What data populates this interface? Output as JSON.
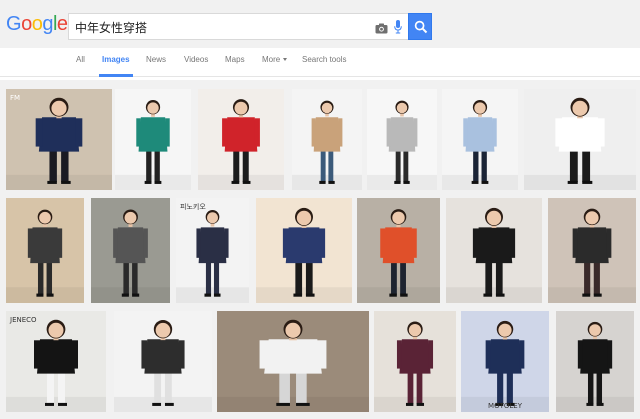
{
  "logo": {
    "letters": [
      "G",
      "o",
      "o",
      "g",
      "l",
      "e"
    ]
  },
  "search": {
    "query": "中年女性穿搭"
  },
  "tabs": [
    {
      "label": "All"
    },
    {
      "label": "Images"
    },
    {
      "label": "News"
    },
    {
      "label": "Videos"
    },
    {
      "label": "Maps"
    },
    {
      "label": "More"
    },
    {
      "label": "Search tools"
    }
  ],
  "results": {
    "row1": [
      {
        "watermark": "FM",
        "bg": "#cfc2b0",
        "coat": "#1f2f5a",
        "pants": "#1a1a22"
      },
      {
        "bg": "#f6f6f6",
        "coat": "#1e8a7a",
        "pants": "#222"
      },
      {
        "bg": "#f2eeea",
        "coat": "#d0232a",
        "pants": "#1c1c1c"
      },
      {
        "bg": "#f4f4f4",
        "coat": "#c9a27a",
        "pants": "#3b5a7a"
      },
      {
        "bg": "#f7f7f7",
        "coat": "#b9b9b9",
        "pants": "#2a2a2a"
      },
      {
        "bg": "#f5f5f5",
        "coat": "#a9c1df",
        "pants": "#1b2436"
      },
      {
        "bg": "#efefef",
        "coat": "#ffffff",
        "pants": "#1b1b1b"
      }
    ],
    "row2": [
      {
        "bg": "#d7c4a8",
        "coat": "#3a3a3a",
        "pants": "#2a2a2a"
      },
      {
        "bg": "#9a9a92",
        "coat": "#555555",
        "pants": "#2a2a2a"
      },
      {
        "watermark": "피노키오",
        "bg": "#f3f3f3",
        "coat": "#2a2f45",
        "pants": "#2a2f45"
      },
      {
        "bg": "#f2e4d2",
        "coat": "#2a3a6e",
        "pants": "#1a1a1a"
      },
      {
        "bg": "#b8b0a5",
        "coat": "#e0502a",
        "pants": "#1e2430"
      },
      {
        "bg": "#e6e2dd",
        "coat": "#1a1a1a",
        "pants": "#1a1a1a"
      },
      {
        "bg": "#cfc3b8",
        "coat": "#2b2b2b",
        "pants": "#3a2a2a"
      }
    ],
    "row3": [
      {
        "watermark": "JENECO",
        "bg": "#e9e9e6",
        "coat": "#141414",
        "pants": "#f4f4f4"
      },
      {
        "bg": "#f3f3f3",
        "coat": "#2d2d2d",
        "pants": "#e0e0e0"
      },
      {
        "bg": "#9b8b7a",
        "coat": "#f2f2f2",
        "pants": "#d6d6d6"
      },
      {
        "bg": "#e6e1da",
        "coat": "#5a2336",
        "pants": "#5a2336"
      },
      {
        "watermark": "MOTOLEY",
        "bg": "#cfd6e8",
        "coat": "#1e2f58",
        "pants": "#1e2f58"
      },
      {
        "bg": "#d6d3d0",
        "coat": "#151515",
        "pants": "#151515"
      }
    ]
  }
}
